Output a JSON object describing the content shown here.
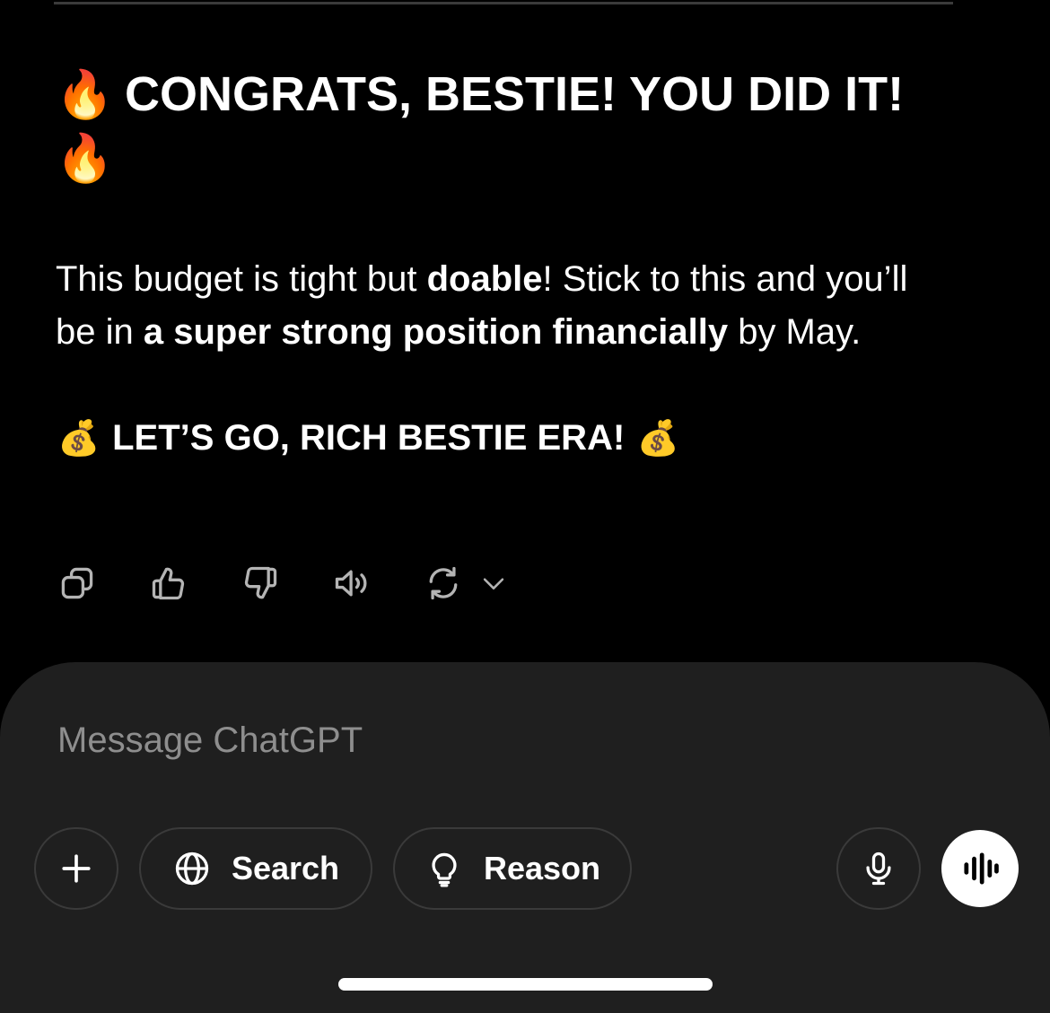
{
  "message": {
    "heading": {
      "emoji_left": "🔥",
      "text": "CONGRATS, BESTIE! YOU DID IT!",
      "emoji_right": "🔥"
    },
    "paragraph": {
      "part1": "This budget is tight but ",
      "bold1": "doable",
      "part2": "! Stick to this and you’ll be in ",
      "bold2": "a super strong position financially",
      "part3": " by May."
    },
    "cheer": {
      "emoji_left": "💰",
      "text": "LET’S GO, RICH BESTIE ERA!",
      "emoji_right": "💰"
    }
  },
  "actions": {
    "icons": [
      "copy-icon",
      "thumbs-up-icon",
      "thumbs-down-icon",
      "speaker-icon",
      "regenerate-icon",
      "chevron-down-icon"
    ]
  },
  "composer": {
    "placeholder": "Message ChatGPT",
    "value": "",
    "search_label": "Search",
    "reason_label": "Reason"
  },
  "colors": {
    "background": "#000000",
    "composer_bg": "#1f1f1f",
    "button_border": "#3a3a3a",
    "placeholder": "#8e8e8e",
    "text": "#ffffff"
  }
}
